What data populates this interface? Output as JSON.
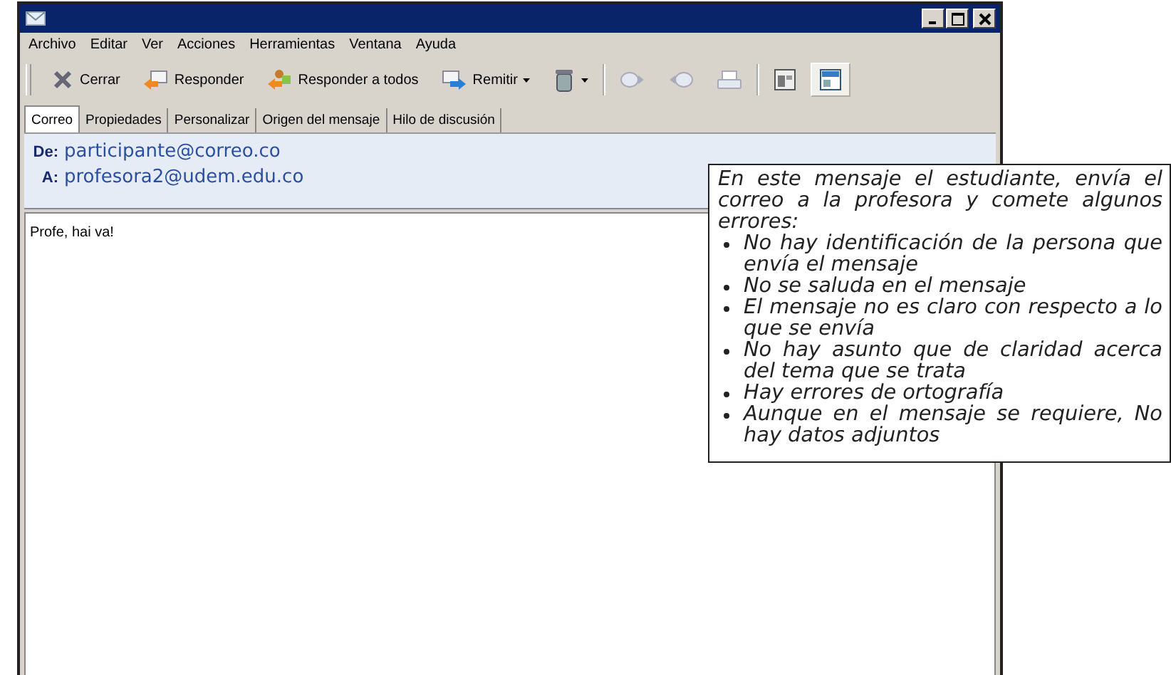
{
  "window": {
    "controls": [
      {
        "kind": "minimize"
      },
      {
        "kind": "maximize"
      },
      {
        "kind": "close"
      }
    ]
  },
  "menu": [
    "Archivo",
    "Editar",
    "Ver",
    "Acciones",
    "Herramientas",
    "Ventana",
    "Ayuda"
  ],
  "toolbar": [
    {
      "kind": "close",
      "label": "Cerrar"
    },
    {
      "kind": "reply",
      "label": "Responder"
    },
    {
      "kind": "reply-all",
      "label": "Responder a todos"
    },
    {
      "kind": "forward",
      "label": "Remitir",
      "dropdown": true
    },
    {
      "kind": "trash",
      "dropdown": true
    },
    {
      "kind": "separator"
    },
    {
      "kind": "next",
      "selected": false
    },
    {
      "kind": "previous",
      "selected": false
    },
    {
      "kind": "print",
      "selected": false
    },
    {
      "kind": "separator"
    },
    {
      "kind": "view",
      "selected": false
    },
    {
      "kind": "preview",
      "selected": true
    }
  ],
  "tabs": [
    {
      "label": "Correo",
      "selected": true
    },
    {
      "label": "Propiedades",
      "selected": false
    },
    {
      "label": "Personalizar",
      "selected": false
    },
    {
      "label": "Origen del mensaje",
      "selected": false
    },
    {
      "label": "Hilo de discusión",
      "selected": false
    }
  ],
  "header": {
    "from_label": "De:",
    "from": "participante@correo.co",
    "to_label": "A:",
    "to": "profesora2@udem.edu.co"
  },
  "body": "Profe, hai va!",
  "callout": {
    "intro": "En este mensaje el estudiante, envía el correo a la profesora y comete algunos errores:",
    "items": [
      "No hay identificación de la persona que envía el mensaje",
      "No se saluda en el mensaje",
      "El mensaje no es claro con respecto a lo que se envía",
      "No hay asunto que de claridad acerca del tema que se trata",
      "Hay errores de ortografía",
      "Aunque en el mensaje se requiere, No hay datos adjuntos"
    ]
  }
}
